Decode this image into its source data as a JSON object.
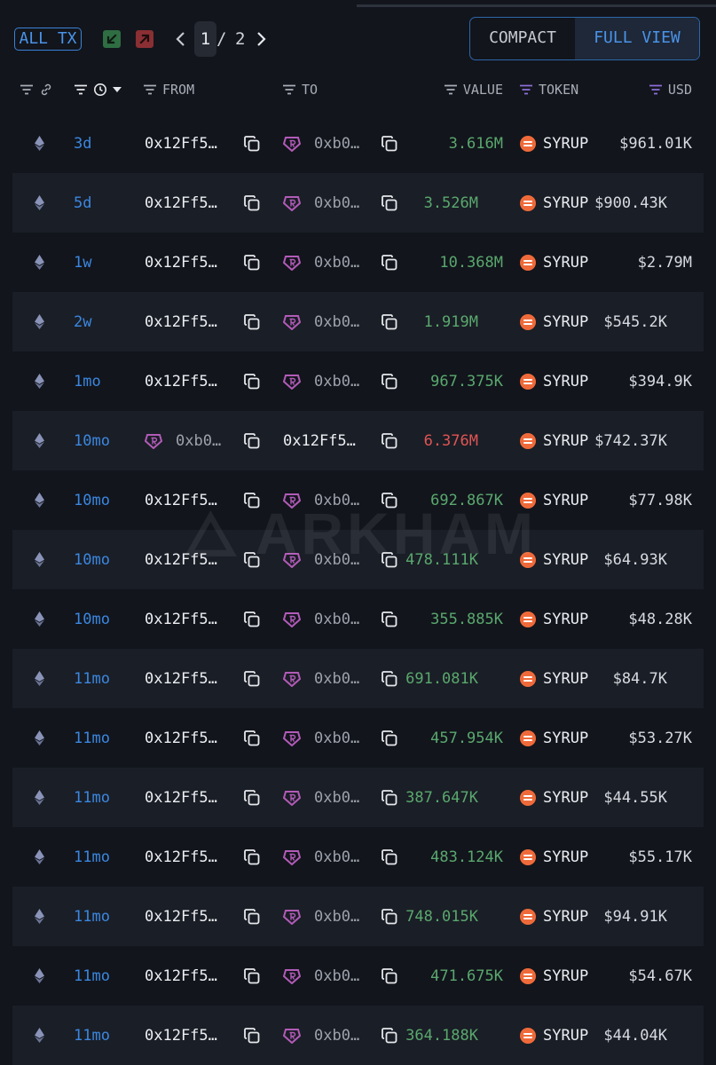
{
  "toolbar": {
    "all_tx_label": "ALL TX",
    "pagination": {
      "current": "1",
      "separator": "/",
      "total": "2"
    },
    "views": {
      "compact": "COMPACT",
      "full": "FULL VIEW",
      "active": "FULL VIEW"
    }
  },
  "columns": {
    "from": "FROM",
    "to": "TO",
    "value": "VALUE",
    "token": "TOKEN",
    "usd": "USD"
  },
  "watermark": "ARKHAM",
  "colors": {
    "background": "#12151c",
    "row_alt": "#1a1e26",
    "accent_blue": "#3b87e0",
    "incoming_green": "#5aa86e",
    "outgoing_red": "#e05454",
    "entity_purple": "#b25bb8",
    "token_orange": "#ef6a3a"
  },
  "icons": {
    "chain": "ethereum-icon",
    "copy": "copy-icon",
    "entity": "entity-badge-icon",
    "token": "syrup-token-icon"
  },
  "rows": [
    {
      "time": "3d",
      "from": "0x12Ff5…",
      "to": "0xb0…",
      "value": "3.616M",
      "token": "SYRUP",
      "usd": "$961.01K",
      "direction": "in"
    },
    {
      "time": "5d",
      "from": "0x12Ff5…",
      "to": "0xb0…",
      "value": "3.526M",
      "token": "SYRUP",
      "usd": "$900.43K",
      "direction": "in"
    },
    {
      "time": "1w",
      "from": "0x12Ff5…",
      "to": "0xb0…",
      "value": "10.368M",
      "token": "SYRUP",
      "usd": "$2.79M",
      "direction": "in"
    },
    {
      "time": "2w",
      "from": "0x12Ff5…",
      "to": "0xb0…",
      "value": "1.919M",
      "token": "SYRUP",
      "usd": "$545.2K",
      "direction": "in"
    },
    {
      "time": "1mo",
      "from": "0x12Ff5…",
      "to": "0xb0…",
      "value": "967.375K",
      "token": "SYRUP",
      "usd": "$394.9K",
      "direction": "in"
    },
    {
      "time": "10mo",
      "from": "0xb0…",
      "to": "0x12Ff5…",
      "value": "6.376M",
      "token": "SYRUP",
      "usd": "$742.37K",
      "direction": "out"
    },
    {
      "time": "10mo",
      "from": "0x12Ff5…",
      "to": "0xb0…",
      "value": "692.867K",
      "token": "SYRUP",
      "usd": "$77.98K",
      "direction": "in"
    },
    {
      "time": "10mo",
      "from": "0x12Ff5…",
      "to": "0xb0…",
      "value": "478.111K",
      "token": "SYRUP",
      "usd": "$64.93K",
      "direction": "in"
    },
    {
      "time": "10mo",
      "from": "0x12Ff5…",
      "to": "0xb0…",
      "value": "355.885K",
      "token": "SYRUP",
      "usd": "$48.28K",
      "direction": "in"
    },
    {
      "time": "11mo",
      "from": "0x12Ff5…",
      "to": "0xb0…",
      "value": "691.081K",
      "token": "SYRUP",
      "usd": "$84.7K",
      "direction": "in"
    },
    {
      "time": "11mo",
      "from": "0x12Ff5…",
      "to": "0xb0…",
      "value": "457.954K",
      "token": "SYRUP",
      "usd": "$53.27K",
      "direction": "in"
    },
    {
      "time": "11mo",
      "from": "0x12Ff5…",
      "to": "0xb0…",
      "value": "387.647K",
      "token": "SYRUP",
      "usd": "$44.55K",
      "direction": "in"
    },
    {
      "time": "11mo",
      "from": "0x12Ff5…",
      "to": "0xb0…",
      "value": "483.124K",
      "token": "SYRUP",
      "usd": "$55.17K",
      "direction": "in"
    },
    {
      "time": "11mo",
      "from": "0x12Ff5…",
      "to": "0xb0…",
      "value": "748.015K",
      "token": "SYRUP",
      "usd": "$94.91K",
      "direction": "in"
    },
    {
      "time": "11mo",
      "from": "0x12Ff5…",
      "to": "0xb0…",
      "value": "471.675K",
      "token": "SYRUP",
      "usd": "$54.67K",
      "direction": "in"
    },
    {
      "time": "11mo",
      "from": "0x12Ff5…",
      "to": "0xb0…",
      "value": "364.188K",
      "token": "SYRUP",
      "usd": "$44.04K",
      "direction": "in"
    }
  ]
}
